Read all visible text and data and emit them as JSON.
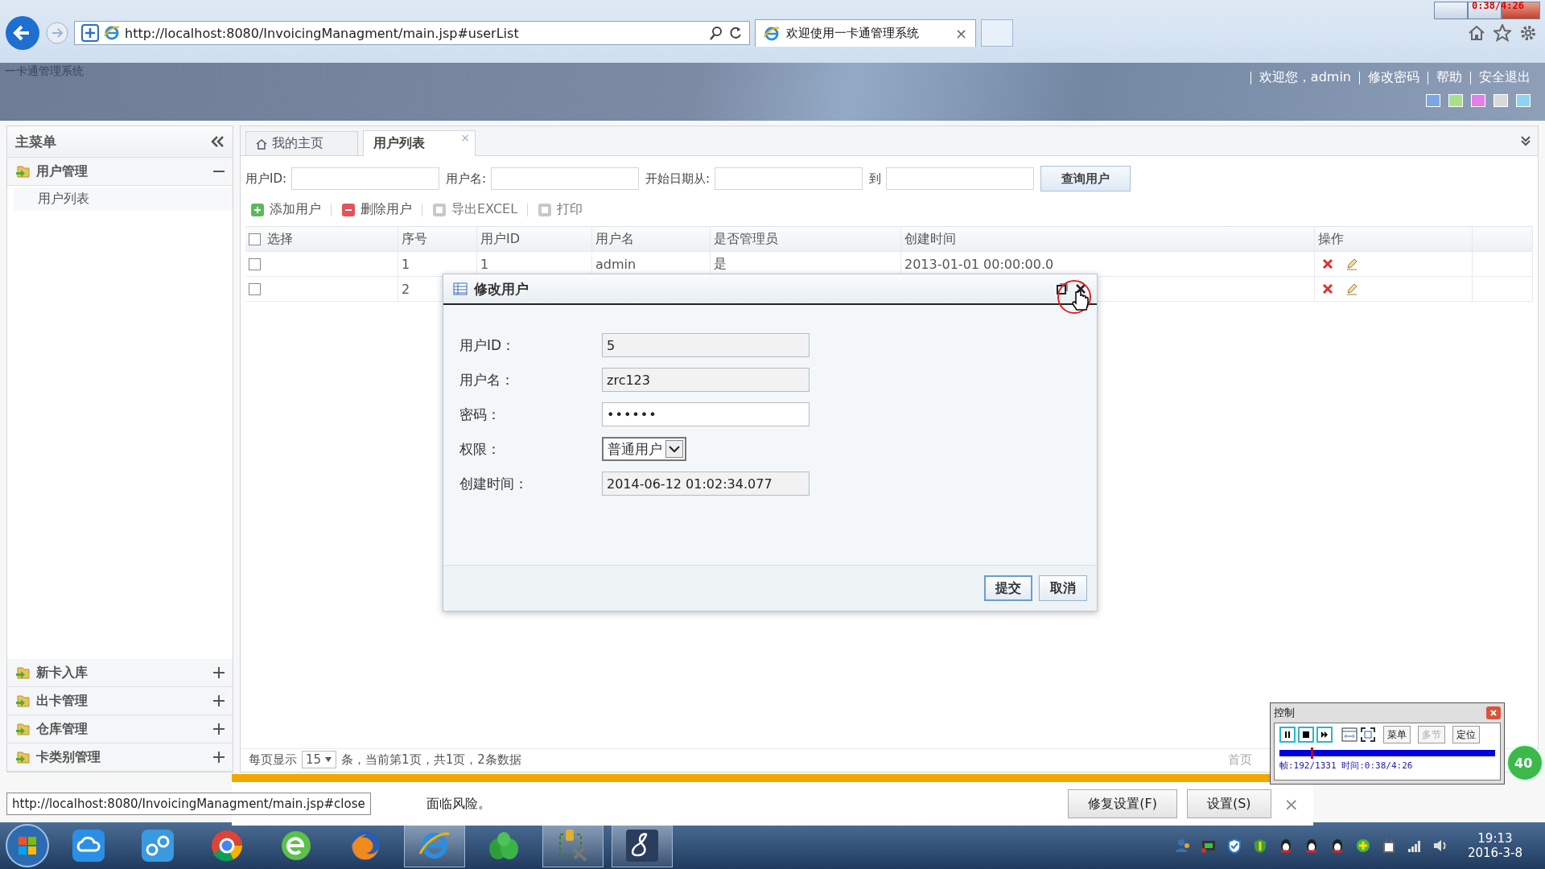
{
  "browser": {
    "url": "http://localhost:8080/InvoicingManagment/main.jsp#userList",
    "tab_title": "欢迎使用一卡通管理系统",
    "tab_close": "×"
  },
  "recorder_timer": "0:38/4:26",
  "header": {
    "title": "一卡通管理系统",
    "links": [
      "欢迎您，admin",
      "修改密码",
      "帮助",
      "安全退出"
    ],
    "themes": [
      {
        "color": "#7aa7e0"
      },
      {
        "color": "#a6e08a"
      },
      {
        "color": "#e57ee5"
      },
      {
        "color": "#d9d9d9"
      },
      {
        "color": "#8ed3f2"
      }
    ]
  },
  "sidebar": {
    "title": "主菜单",
    "groups": [
      {
        "label": "用户管理",
        "expanded": true,
        "children": [
          {
            "label": "用户列表"
          }
        ]
      },
      {
        "label": "新卡入库",
        "expanded": false
      },
      {
        "label": "出卡管理",
        "expanded": false
      },
      {
        "label": "仓库管理",
        "expanded": false
      },
      {
        "label": "卡类别管理",
        "expanded": false
      }
    ]
  },
  "tabs": [
    {
      "label": "我的主页",
      "selected": false
    },
    {
      "label": "用户列表",
      "selected": true,
      "close": "×"
    }
  ],
  "search": {
    "fields": [
      {
        "label": "用户ID:"
      },
      {
        "label": "用户名:"
      },
      {
        "label": "开始日期从:"
      },
      {
        "label": "到"
      }
    ],
    "button": "查询用户"
  },
  "toolbar": [
    {
      "label": "添加用户",
      "kind": "add",
      "disabled": false
    },
    {
      "label": "删除用户",
      "kind": "delete",
      "disabled": false
    },
    {
      "label": "导出EXCEL",
      "kind": "export",
      "disabled": true
    },
    {
      "label": "打印",
      "kind": "print",
      "disabled": true
    }
  ],
  "table": {
    "all_checked": false,
    "columns": [
      "选择",
      "序号",
      "用户ID",
      "用户名",
      "是否管理员",
      "创建时间",
      "操作"
    ],
    "rows": [
      {
        "checked": false,
        "cells": [
          "",
          "1",
          "1",
          "admin",
          "是",
          "2013-01-01 00:00:00.0"
        ]
      },
      {
        "checked": false,
        "cells": [
          "",
          "2"
        ]
      }
    ]
  },
  "pager": {
    "before": "每页显示",
    "page_size": "15",
    "after": "条，当前第1页，共1页，2条数据",
    "first": "首页"
  },
  "dialog": {
    "title": "修改用户",
    "fields": [
      {
        "kind": "text",
        "label": "用户ID：",
        "value": "5"
      },
      {
        "kind": "text",
        "label": "用户名：",
        "value": "zrc123"
      },
      {
        "kind": "password",
        "label": "密码：",
        "value": "••••••"
      },
      {
        "kind": "select",
        "label": "权限：",
        "value": "普通用户"
      },
      {
        "kind": "text",
        "label": "创建时间：",
        "value": "2014-06-12 01:02:34.077"
      }
    ],
    "buttons": [
      "提交",
      "取消"
    ]
  },
  "notification": {
    "message": "面临风险。",
    "buttons": [
      "修复设置(F)",
      "设置(S)"
    ],
    "close": "×"
  },
  "status_tooltip": "http://localhost:8080/InvoicingManagment/main.jsp#close",
  "recorder": {
    "title": "控制",
    "buttons": [
      {
        "label": "菜单",
        "disabled": false
      },
      {
        "label": "多节",
        "disabled": true
      },
      {
        "label": "定位",
        "disabled": false
      }
    ],
    "level": 0.144,
    "info": "帧:192/1331 时间:0:38/4:26"
  },
  "side_badge": "40",
  "taskbar": {
    "apps": [
      {
        "kind": "cloud",
        "running": false
      },
      {
        "kind": "share",
        "running": false
      },
      {
        "kind": "chrome",
        "running": false
      },
      {
        "kind": "green-e",
        "running": false
      },
      {
        "kind": "firefox",
        "running": false
      },
      {
        "kind": "ie",
        "running": true
      },
      {
        "kind": "leaf",
        "running": false
      },
      {
        "kind": "tool",
        "running": true
      },
      {
        "kind": "eight",
        "running": true
      }
    ],
    "time": "19:13",
    "date": "2016-3-8"
  }
}
